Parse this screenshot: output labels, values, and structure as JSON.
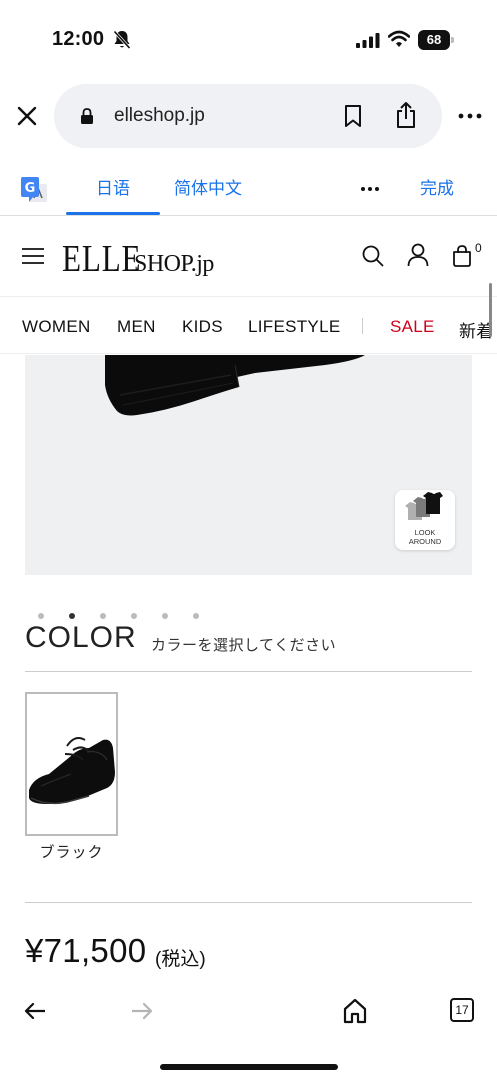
{
  "status_bar": {
    "time": "12:00",
    "battery": "68"
  },
  "browser": {
    "url": "elleshop.jp"
  },
  "translate": {
    "tab_ja": "日语",
    "tab_zh": "简体中文",
    "done": "完成"
  },
  "site": {
    "logo_main": "ELLE",
    "logo_sub": "SHOP.jp",
    "cart_count": "0",
    "nav": [
      "WOMEN",
      "MEN",
      "KIDS",
      "LIFESTYLE",
      "SALE",
      "新着"
    ]
  },
  "product": {
    "look_around_label_1": "LOOK",
    "look_around_label_2": "AROUND",
    "carousel": {
      "count": 6,
      "active_index": 1
    },
    "color_title": "COLOR",
    "color_subtitle": "カラーを選択してください",
    "colors": [
      {
        "label": "ブラック",
        "selected": true
      }
    ],
    "price": "¥71,500",
    "price_tax": "(税込)"
  },
  "toolbar": {
    "tab_count": "17"
  },
  "colors": {
    "link": "#1a73e8",
    "sale": "#d0021b",
    "image_bg": "#eef0f2"
  }
}
